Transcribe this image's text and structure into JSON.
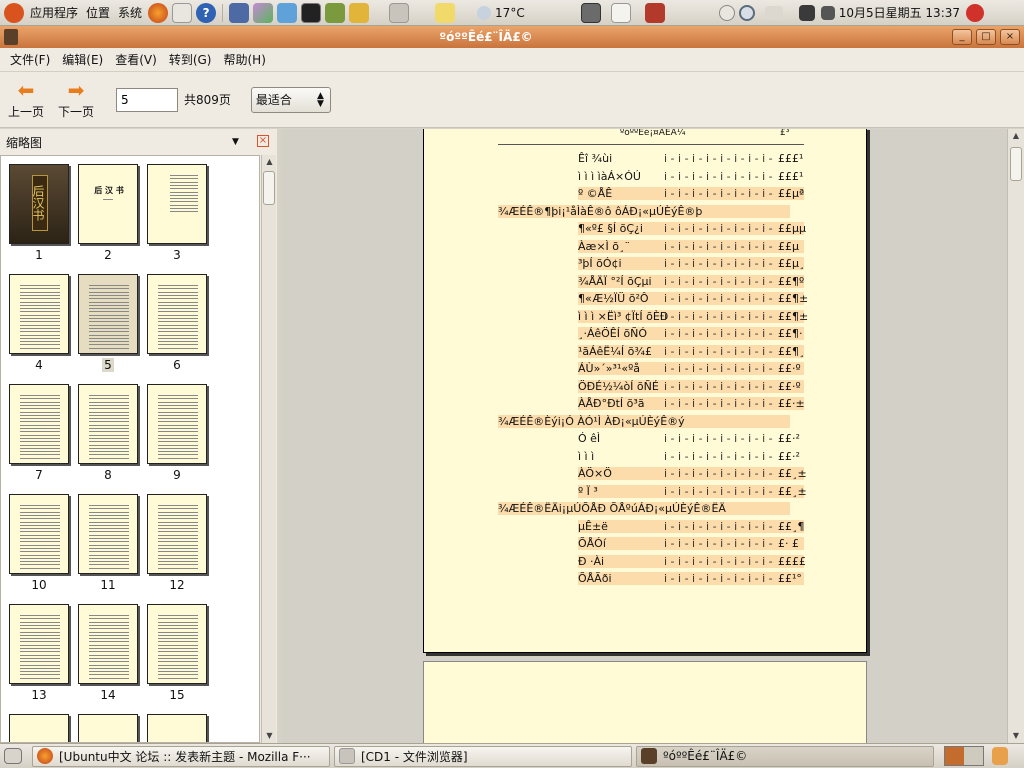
{
  "top_panel": {
    "menu_apps": "应用程序",
    "menu_places": "位置",
    "menu_system": "系统",
    "weather": "17°C",
    "clock": "10月5日星期五 13:37"
  },
  "window": {
    "title": "ºóººÊé£¨ÎÄ£©",
    "min": "_",
    "max": "□",
    "close": "×"
  },
  "menubar": {
    "items": [
      "文件(F)",
      "编辑(E)",
      "查看(V)",
      "转到(G)",
      "帮助(H)"
    ]
  },
  "toolbar": {
    "prev": "上一页",
    "next": "下一页",
    "page_value": "5",
    "total": "共809页",
    "zoom": "最适合"
  },
  "sidebar": {
    "title": "缩略图",
    "selected_page": "5",
    "thumb_numbers": [
      "1",
      "2",
      "3",
      "4",
      "5",
      "6",
      "7",
      "8",
      "9",
      "10",
      "11",
      "12",
      "13",
      "14",
      "15"
    ],
    "cover_text": "后汉书",
    "page2_text": "后 汉 书"
  },
  "document": {
    "running_header": "ºóººÊé¡¤ÄÊÂ¼",
    "page_number": "£³",
    "rows": [
      {
        "label": "Êî ¾ùi",
        "num": "£££¹",
        "hl": false,
        "sec": false
      },
      {
        "label": "ì ì ì ìàÁ×ÓÚ",
        "num": "£££¹",
        "hl": false,
        "sec": false
      },
      {
        "label": "º ©ÅÊ",
        "num": "££µª",
        "hl": true,
        "sec": false
      },
      {
        "label": "¾ÆÉÊ®¶þi¡¹åÌàÊ®ô ôÁÐ¡«µÚÈýÊ®þ",
        "num": "",
        "hl": true,
        "sec": true
      },
      {
        "label": "¶«º£ §Í õÇ¿i",
        "num": "££µµ",
        "hl": true,
        "sec": false
      },
      {
        "label": "Àæ×Ì õ¸¨",
        "num": "££µ",
        "hl": true,
        "sec": false
      },
      {
        "label": "³þÍ õÓ¢i",
        "num": "££µ¸",
        "hl": true,
        "sec": false
      },
      {
        "label": "¾ÅÄÏ °²Í õÇµi",
        "num": "££¶º",
        "hl": true,
        "sec": false
      },
      {
        "label": "¶«Æ½ÏÜ õ²Ô",
        "num": "££¶±",
        "hl": true,
        "sec": false
      },
      {
        "label": "ì ì ì ×Ëì³ ¢ÏtÍ õÈÐ",
        "num": "££¶±",
        "hl": true,
        "sec": false
      },
      {
        "label": "¸·ÁêÖÊÍ õÑÓ",
        "num": "££¶·",
        "hl": true,
        "sec": false
      },
      {
        "label": "¹ãÁêË¼Í õ¾£",
        "num": "££¶¸",
        "hl": true,
        "sec": false
      },
      {
        "label": "ÁÙ»´»³¹«ºå",
        "num": "££·º",
        "hl": true,
        "sec": false
      },
      {
        "label": "ÖÐÉ½¼òÍ õÑÉ",
        "num": "££·º",
        "hl": true,
        "sec": false
      },
      {
        "label": "ÀÅÐ°ÐtÍ õ³ã",
        "num": "££·±",
        "hl": true,
        "sec": false
      },
      {
        "label": "¾ÆÉÊ®Èýi¡Ó ÀÓ¹Ì ÀÐ¡«µÚÈýÊ®ý",
        "num": "",
        "hl": true,
        "sec": true
      },
      {
        "label": "Ó êÌ",
        "num": "££·²",
        "hl": false,
        "sec": false
      },
      {
        "label": "ì ì ì",
        "num": "££·²",
        "hl": false,
        "sec": false
      },
      {
        "label": "ÀÖ×Ö",
        "num": "££¸±",
        "hl": true,
        "sec": false
      },
      {
        "label": "º Ï ³",
        "num": "££¸±",
        "hl": true,
        "sec": false
      },
      {
        "label": "¾ÆÉÊ®ËÄi¡µÚÕÅÐ ÕÅºúÁÐ¡«µÚÈýÊ®ËÄ",
        "num": "",
        "hl": true,
        "sec": true
      },
      {
        "label": "µÊ±ë",
        "num": "££¸¶",
        "hl": true,
        "sec": false
      },
      {
        "label": "ÕÅÓí",
        "num": "£· £",
        "hl": true,
        "sec": false
      },
      {
        "label": "Ð ·Ài",
        "num": "££££",
        "hl": true,
        "sec": false
      },
      {
        "label": "ÕÅÃði",
        "num": "££¹°",
        "hl": true,
        "sec": false
      }
    ]
  },
  "taskbar": {
    "task1": "[Ubuntu中文 论坛 :: 发表新主题 - Mozilla F···",
    "task2": "[CD1 - 文件浏览器]",
    "task3": "ºóººÊé£¨ÎÄ£©"
  },
  "colors": {
    "titlebar": "#d98a51",
    "page_bg": "#fffbd7",
    "highlight": "#fbdcaa",
    "accent_orange": "#e77d1d"
  }
}
